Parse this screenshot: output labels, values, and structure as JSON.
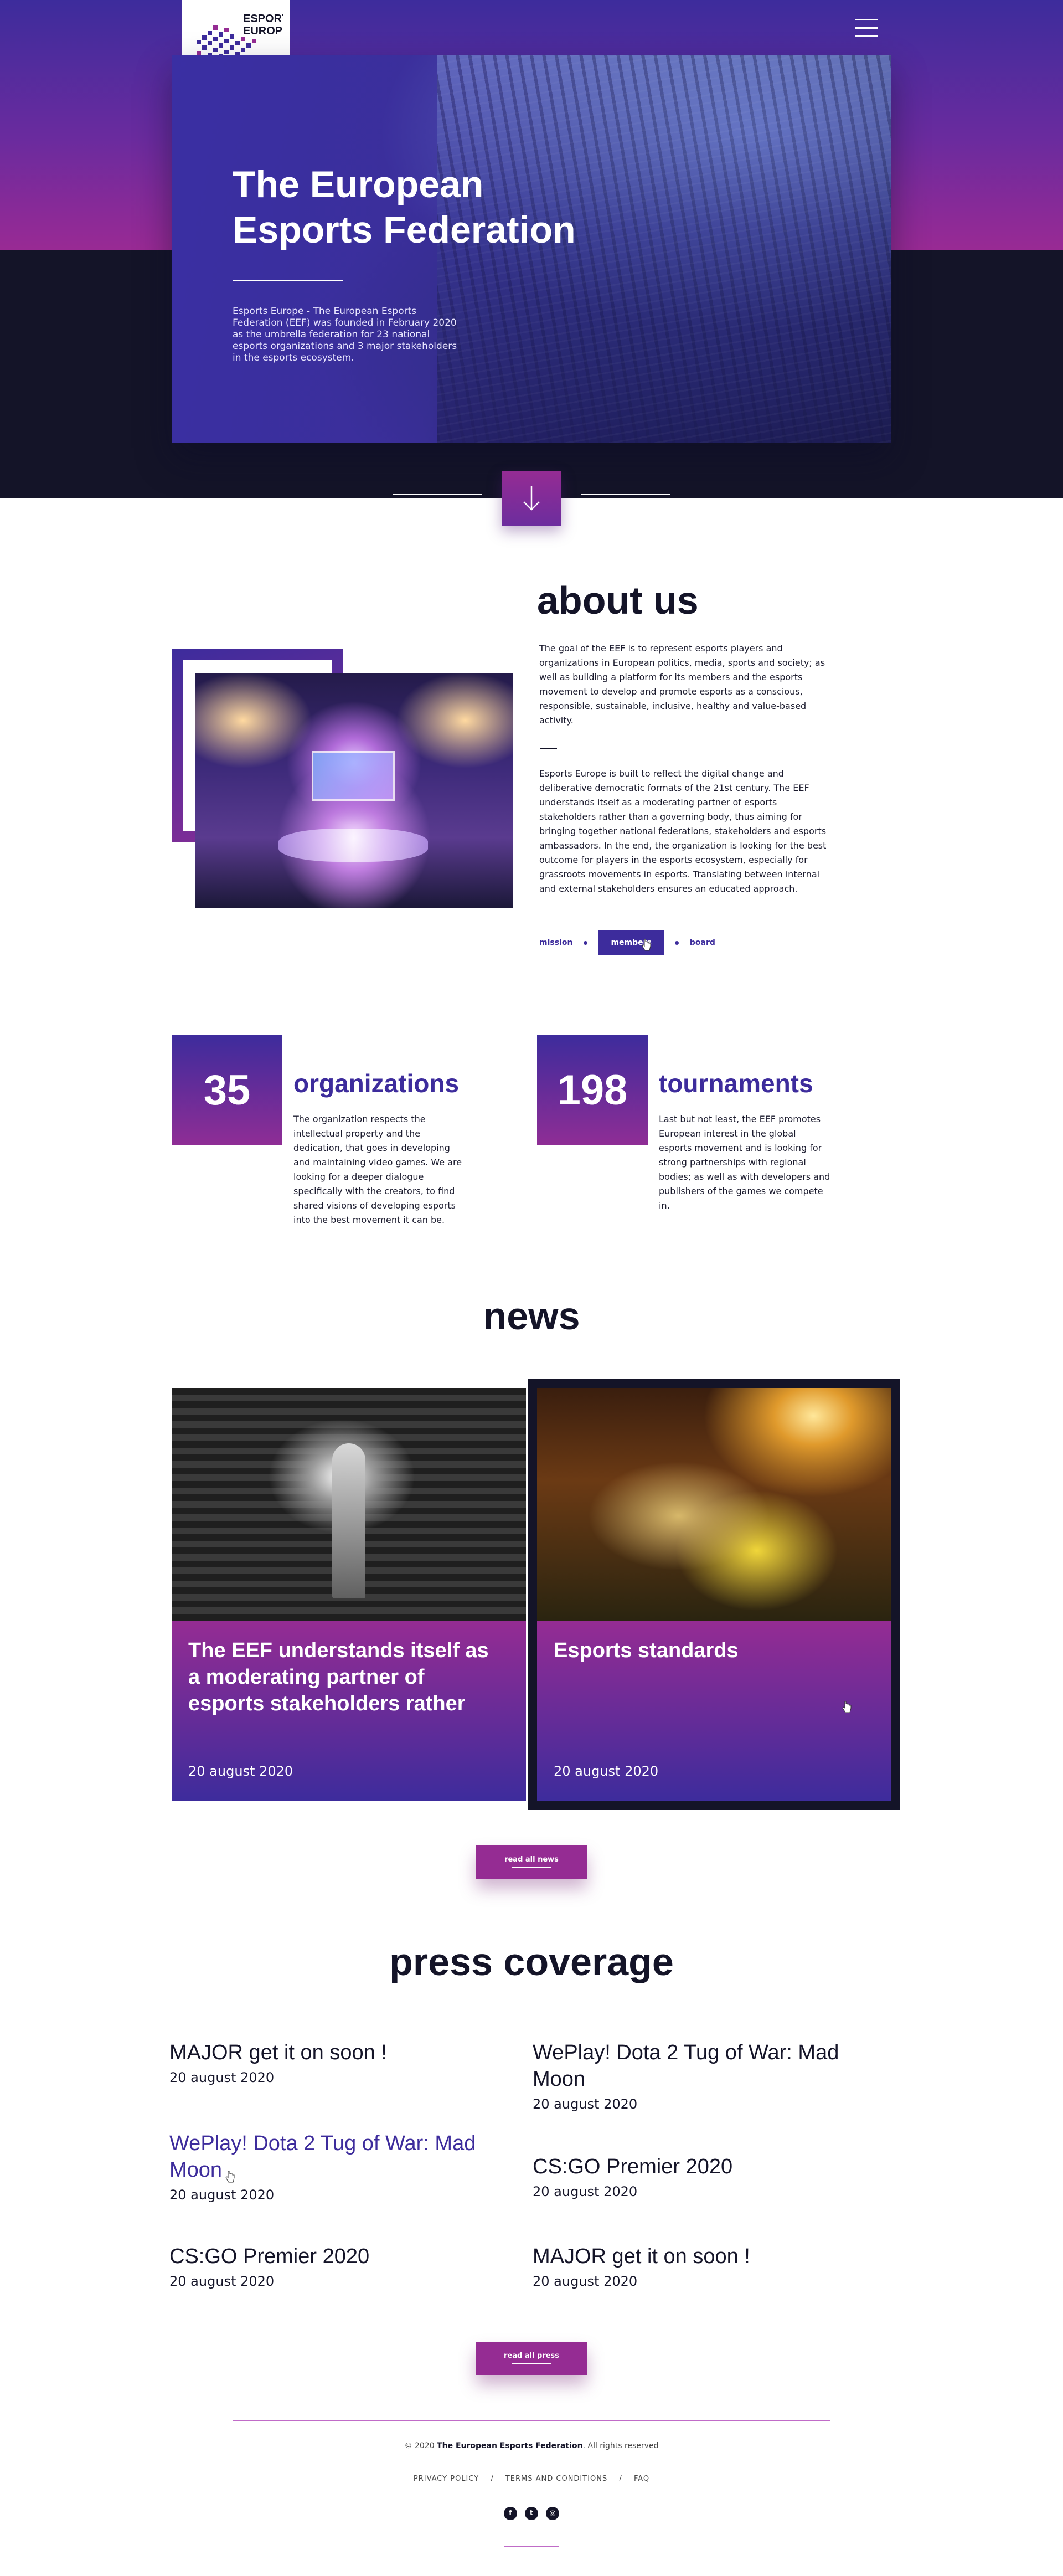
{
  "brand": {
    "logo_text_1": "ESPORTS",
    "logo_text_2": "EUROPE",
    "accent": "#3d2c9c",
    "accent2": "#952c93",
    "dark": "#141428"
  },
  "header": {
    "menu_icon": "hamburger-icon"
  },
  "hero": {
    "title_line1": "The European",
    "title_line2": "Esports Federation",
    "text": "Esports Europe - The European Esports Federation (EEF) was founded in February 2020 as the umbrella federation for 23 national esports organizations and 3 major stakeholders in the esports ecosystem.",
    "scroll_icon": "arrow-down-icon"
  },
  "about": {
    "title": "about us",
    "p1": "The goal of the EEF is to represent esports players and organizations in European politics, media, sports and society; as well as building a platform for its members and the esports movement to develop and promote esports as a conscious, responsible, sustainable, inclusive, healthy and value-based activity.",
    "p2": "Esports Europe is built to reflect the digital change and deliberative democratic formats of the 21st century. The EEF understands itself as a moderating partner of esports stakeholders rather than a governing body, thus aiming for bringing together national federations, stakeholders and esports ambassadors. In the end, the organization is looking for the best outcome for players in the esports ecosystem, especially for grassroots movements in esports. Translating between internal and external stakeholders ensures an educated approach.",
    "tabs": [
      "mission",
      "members",
      "board"
    ],
    "active_tab": "members"
  },
  "stats": [
    {
      "number": "35",
      "title": "organizations",
      "text": "The organization respects the intellectual property and the dedication, that goes in developing and maintaining video games. We are looking for a deeper dialogue specifically with the creators, to find shared visions of developing esports into the best movement it can be."
    },
    {
      "number": "198",
      "title": "tournaments",
      "text": "Last but not least, the EEF promotes European interest in the global esports movement and is looking for strong partnerships with regional bodies; as well as with developers and publishers of the games we compete in."
    }
  ],
  "news": {
    "title": "news",
    "items": [
      {
        "title": "The EEF understands itself as a moderating partner of esports stakeholders rather",
        "date": "20 august 2020"
      },
      {
        "title": "Esports standards",
        "date": "20 august 2020"
      }
    ],
    "cta": "read all news"
  },
  "press": {
    "title": "press coverage",
    "items": [
      {
        "title": "MAJOR get it on soon !",
        "date": "20 august 2020"
      },
      {
        "title": "WePlay! Dota 2 Tug of War: Mad Moon",
        "date": "20 august 2020"
      },
      {
        "title": "WePlay! Dota 2 Tug of War: Mad Moon",
        "date": "20 august 2020"
      },
      {
        "title": "CS:GO Premier 2020",
        "date": "20 august 2020"
      },
      {
        "title": "CS:GO Premier 2020",
        "date": "20 august 2020"
      },
      {
        "title": "MAJOR get it on soon !",
        "date": "20 august 2020"
      }
    ],
    "cta": "read all press"
  },
  "footer": {
    "copy_prefix": "© 2020 ",
    "copy_org": "The European Esports Federation",
    "copy_suffix": ". All rights reserved",
    "links": [
      "PRIVACY POLICY",
      "TERMS AND CONDITIONS",
      "FAQ"
    ],
    "link_separator": "/",
    "socials": [
      {
        "icon": "facebook-icon",
        "glyph": "f"
      },
      {
        "icon": "twitter-icon",
        "glyph": "t"
      },
      {
        "icon": "instagram-icon",
        "glyph": "◎"
      }
    ]
  }
}
